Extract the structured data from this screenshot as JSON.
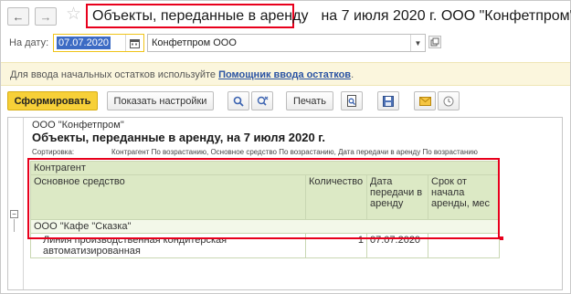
{
  "header": {
    "title_highlighted": "Объекты, переданные в аренду",
    "title_rest": "на 7 июля 2020 г. ООО \"Конфетпром\""
  },
  "filters": {
    "date_label": "На дату:",
    "date_value": "07.07.2020",
    "organization_value": "Конфетпром ООО"
  },
  "info": {
    "text": "Для ввода начальных остатков используйте ",
    "link": "Помощник ввода остатков",
    "suffix": "."
  },
  "toolbar": {
    "generate_label": "Сформировать",
    "show_settings_label": "Показать настройки",
    "print_label": "Печать"
  },
  "report": {
    "organization": "ООО \"Конфетпром\"",
    "title": "Объекты, переданные в аренду, на 7 июля 2020 г.",
    "sort_label": "Сортировка:",
    "sort_value": "Контрагент По возрастанию, Основное средство По возрастанию, Дата передачи в аренду По возрастанию",
    "columns": {
      "group_header": "Контрагент",
      "asset": "Основное средство",
      "quantity": "Количество",
      "transfer_date": "Дата передачи в аренду",
      "term": "Срок от начала аренды, мес"
    },
    "tree_toggle": "−",
    "groups": [
      {
        "name": "ООО \"Кафе \"Сказка\"",
        "rows": [
          {
            "asset": "Линия производственная кондитерская автоматизированная",
            "quantity": "1",
            "transfer_date": "07.07.2020",
            "term": ""
          }
        ]
      }
    ]
  },
  "colors": {
    "accent_yellow": "#f7d038",
    "highlight_red": "#e8001c",
    "header_green": "#dce9c5",
    "link_blue": "#2a53a3"
  }
}
